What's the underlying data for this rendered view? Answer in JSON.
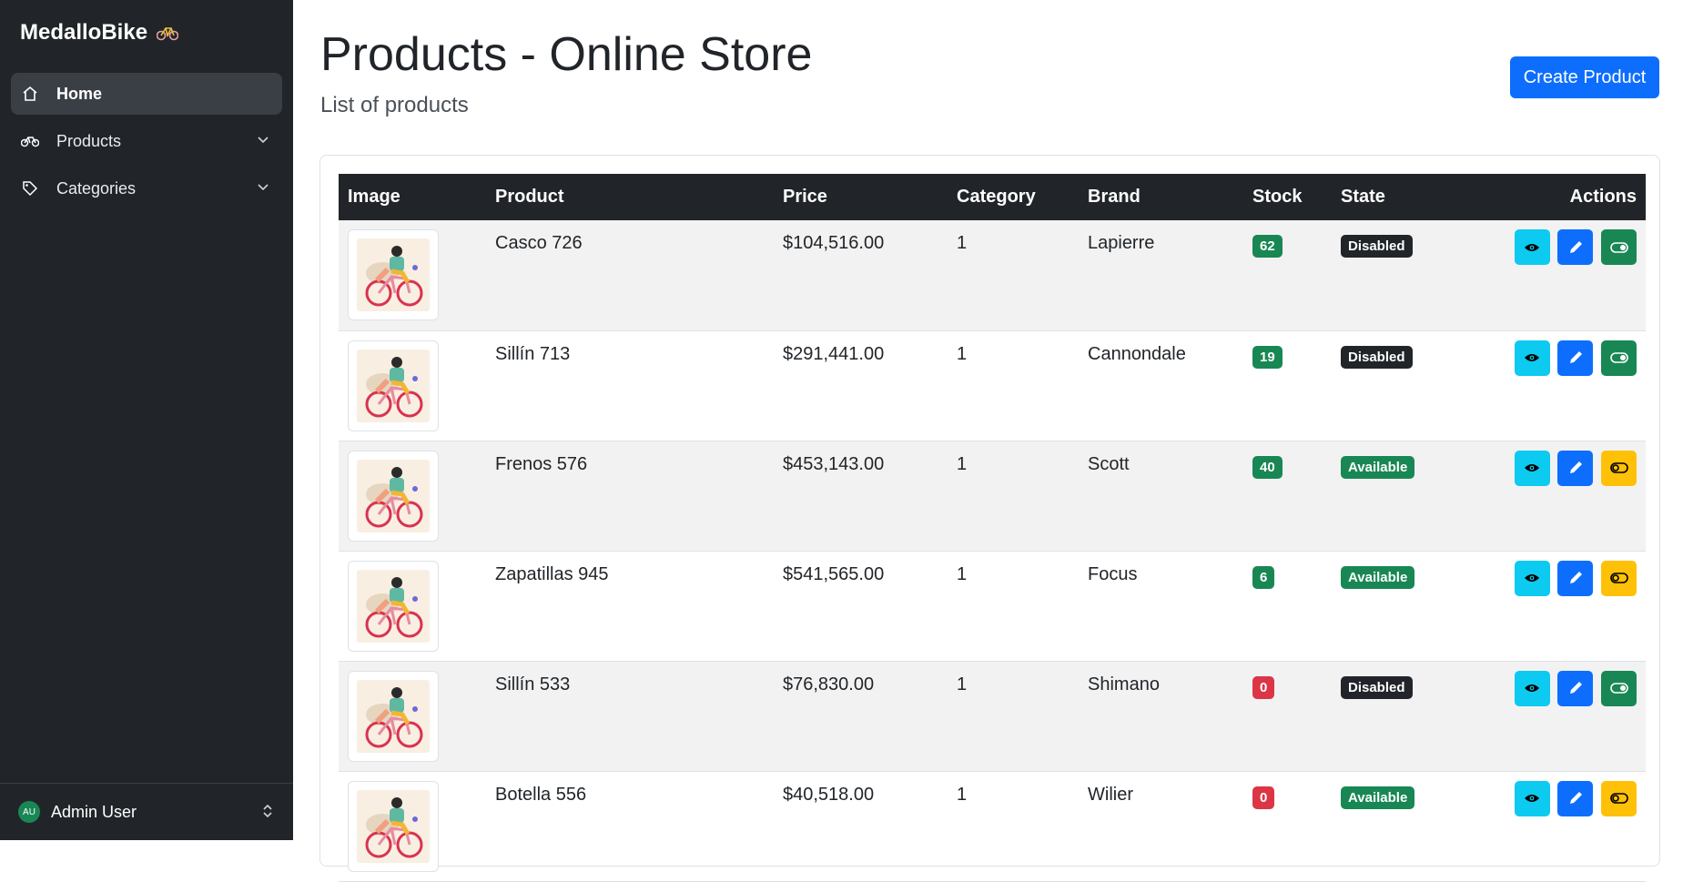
{
  "sidebar": {
    "brand": "MedalloBike",
    "items": [
      {
        "label": "Home"
      },
      {
        "label": "Products"
      },
      {
        "label": "Categories"
      }
    ],
    "user": {
      "initials": "AU",
      "name": "Admin User"
    }
  },
  "header": {
    "title": "Products - Online Store",
    "subtitle": "List of products",
    "create_label": "Create Product"
  },
  "table": {
    "columns": [
      "Image",
      "Product",
      "Price",
      "Category",
      "Brand",
      "Stock",
      "State",
      "Actions"
    ],
    "rows": [
      {
        "product": "Casco 726",
        "price": "$104,516.00",
        "category": "1",
        "brand": "Lapierre",
        "stock": "62",
        "state": "Disabled"
      },
      {
        "product": "Sillín 713",
        "price": "$291,441.00",
        "category": "1",
        "brand": "Cannondale",
        "stock": "19",
        "state": "Disabled"
      },
      {
        "product": "Frenos 576",
        "price": "$453,143.00",
        "category": "1",
        "brand": "Scott",
        "stock": "40",
        "state": "Available"
      },
      {
        "product": "Zapatillas 945",
        "price": "$541,565.00",
        "category": "1",
        "brand": "Focus",
        "stock": "6",
        "state": "Available"
      },
      {
        "product": "Sillín 533",
        "price": "$76,830.00",
        "category": "1",
        "brand": "Shimano",
        "stock": "0",
        "state": "Disabled"
      },
      {
        "product": "Botella 556",
        "price": "$40,518.00",
        "category": "1",
        "brand": "Wilier",
        "stock": "0",
        "state": "Available"
      }
    ]
  },
  "colors": {
    "sidebar_bg": "#212529",
    "primary": "#0d6efd",
    "info": "#0dcaf0",
    "success": "#198754",
    "danger": "#dc3545",
    "warning": "#ffc107",
    "dark": "#212529"
  },
  "icons": {
    "brand": "bicycle-icon",
    "nav": [
      "home-icon",
      "bicycle-icon",
      "tag-icon"
    ],
    "actions": [
      "eye-icon",
      "pencil-icon",
      "toggle-icon"
    ]
  }
}
